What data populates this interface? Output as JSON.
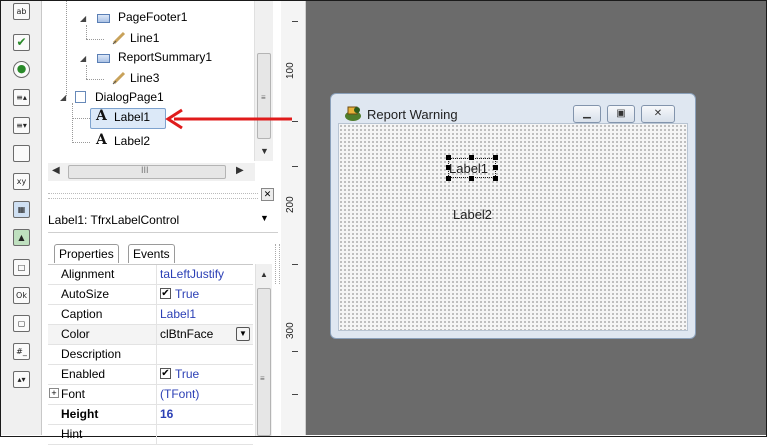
{
  "tree": {
    "nodes": [
      {
        "label": "PageFooter1"
      },
      {
        "label": "Line1"
      },
      {
        "label": "ReportSummary1"
      },
      {
        "label": "Line3"
      },
      {
        "label": "DialogPage1"
      },
      {
        "label": "Label1"
      },
      {
        "label": "Label2"
      }
    ]
  },
  "hscroll_glyph": "III",
  "ruler": {
    "marks": [
      "100",
      "200",
      "300"
    ]
  },
  "design": {
    "dialog_title": "Report Warning",
    "label1": "Label1",
    "label2": "Label2"
  },
  "inspector": {
    "object_combo": "Label1: TfrxLabelControl",
    "tabs": [
      "Properties",
      "Events"
    ],
    "properties": [
      {
        "name": "Alignment",
        "value": "taLeftJustify"
      },
      {
        "name": "AutoSize",
        "value": "True"
      },
      {
        "name": "Caption",
        "value": "Label1"
      },
      {
        "name": "Color",
        "value": "clBtnFace"
      },
      {
        "name": "Description",
        "value": ""
      },
      {
        "name": "Enabled",
        "value": "True"
      },
      {
        "name": "Font",
        "value": "(TFont)"
      },
      {
        "name": "Height",
        "value": "16"
      },
      {
        "name": "Hint",
        "value": ""
      }
    ]
  },
  "colors": {
    "arrow": "#e01b1b",
    "design_bg": "#6b6b6b",
    "selection": "#dce9f8"
  },
  "palette_icons": [
    "edit-icon",
    "checkbox-icon",
    "radio-icon",
    "spin-icon",
    "spin2-icon",
    "panel-icon",
    "datetime-icon",
    "grid-icon",
    "image-icon",
    "shape-icon",
    "ok-button-icon",
    "frame-icon",
    "edit-mask-icon",
    "updown-icon"
  ]
}
